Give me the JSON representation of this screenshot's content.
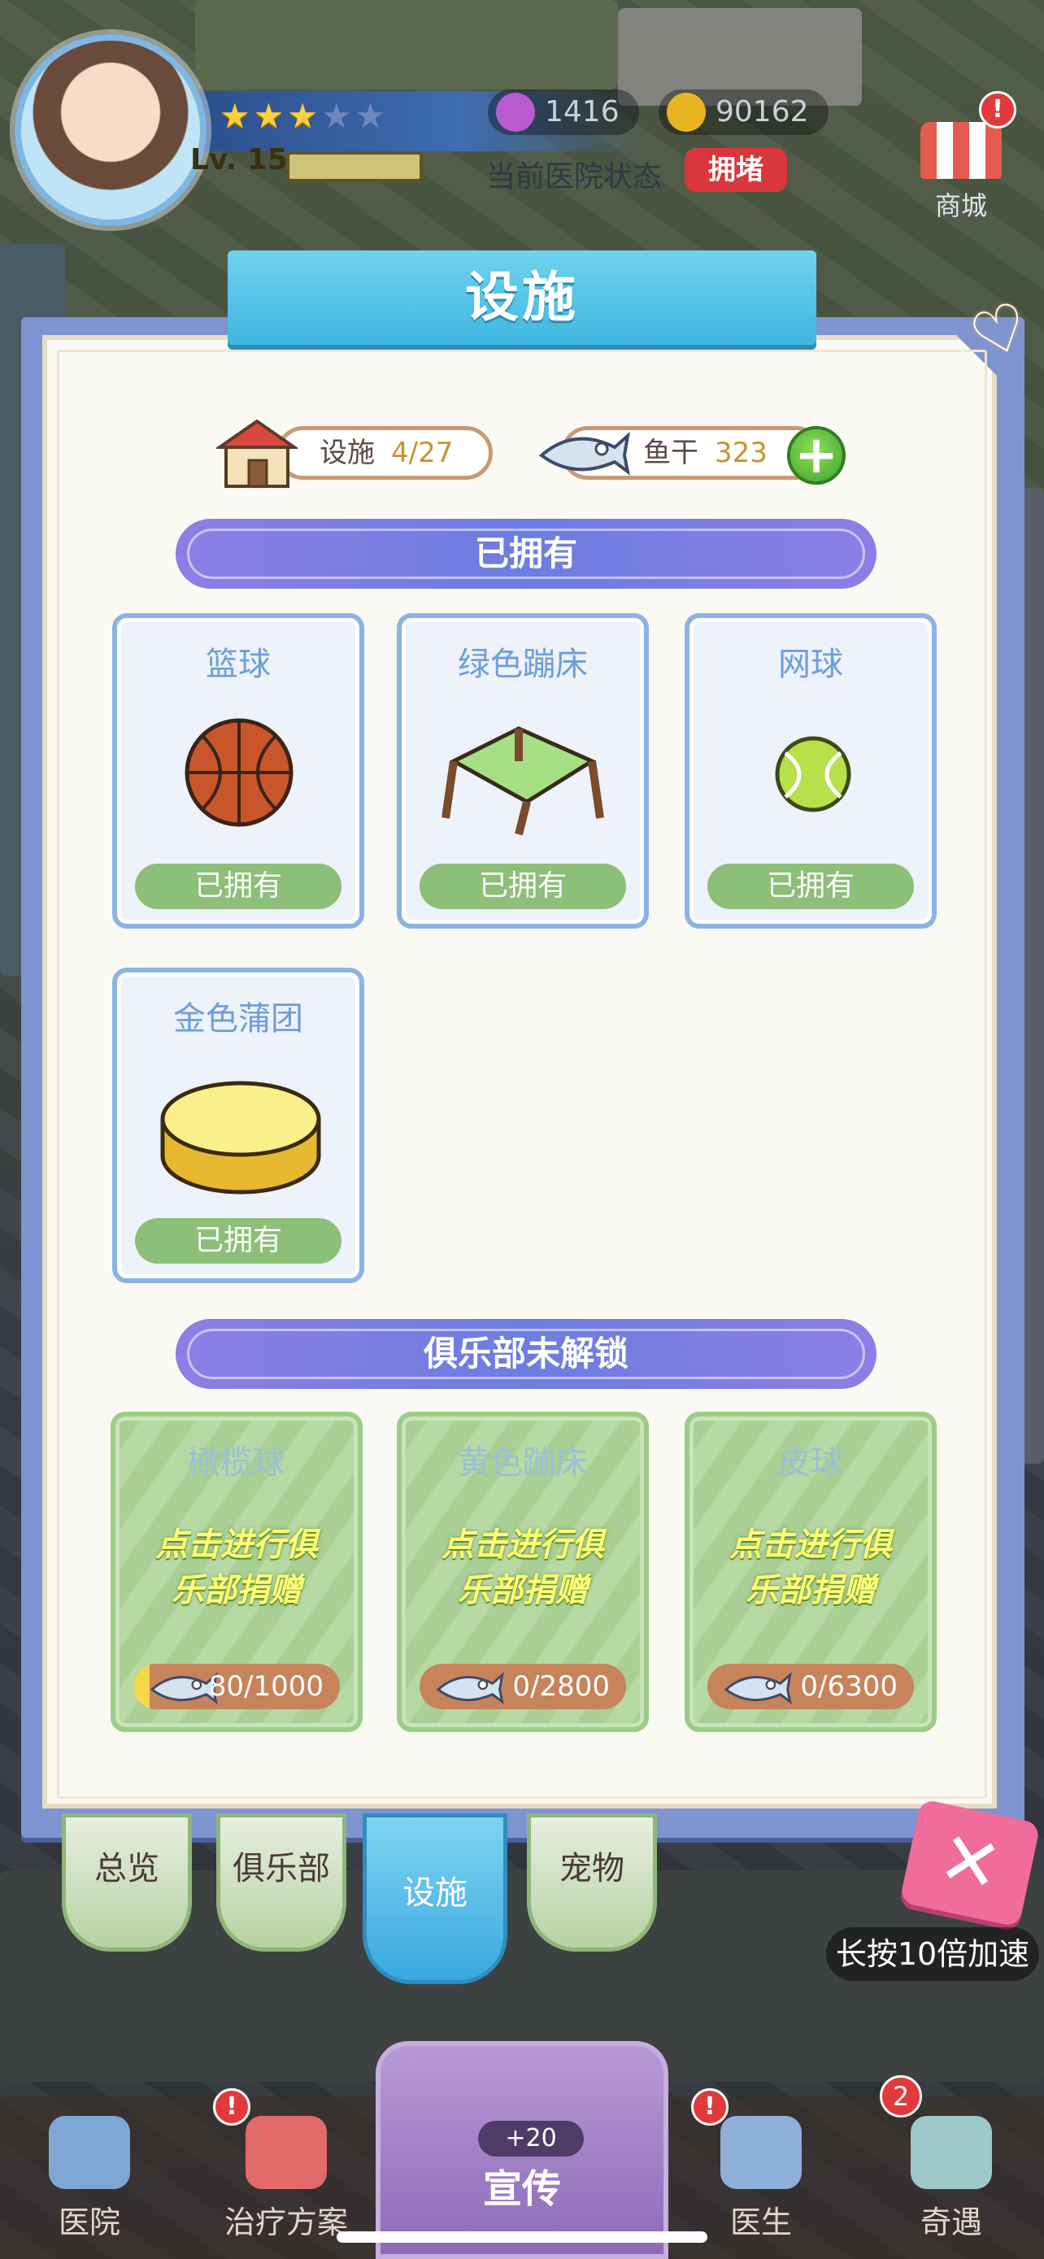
{
  "hud": {
    "level": "Lv. 15",
    "stars_filled": 3,
    "stars_total": 5,
    "gems": "1416",
    "coins": "90162",
    "hospital_status_label": "当前医院状态",
    "hospital_status": "拥堵",
    "shop_label": "商城",
    "alert": "!"
  },
  "modal": {
    "title": "设施",
    "facilities_label": "设施",
    "facilities_count": "4/27",
    "fish_label": "鱼干",
    "fish_count": "323",
    "owned_section": "已拥有",
    "locked_section": "俱乐部未解锁",
    "owned_items": [
      {
        "name": "篮球",
        "button": "已拥有",
        "icon": "basketball-icon"
      },
      {
        "name": "绿色蹦床",
        "button": "已拥有",
        "icon": "trampoline-icon"
      },
      {
        "name": "网球",
        "button": "已拥有",
        "icon": "tennis-ball-icon"
      },
      {
        "name": "金色蒲团",
        "button": "已拥有",
        "icon": "cushion-icon"
      }
    ],
    "locked_items": [
      {
        "name": "橄榄球",
        "hint_line1": "点击进行俱",
        "hint_line2": "乐部捐赠",
        "progress": "80/1000",
        "fraction": 0.08
      },
      {
        "name": "黄色蹦床",
        "hint_line1": "点击进行俱",
        "hint_line2": "乐部捐赠",
        "progress": "0/2800",
        "fraction": 0
      },
      {
        "name": "皮球",
        "hint_line1": "点击进行俱",
        "hint_line2": "乐部捐赠",
        "progress": "0/6300",
        "fraction": 0
      }
    ]
  },
  "tabs": [
    "总览",
    "俱乐部",
    "设施",
    "宠物"
  ],
  "active_tab": "设施",
  "speed_tip": "长按10倍加速",
  "nav": {
    "hospital": "医院",
    "treatment": "治疗方案",
    "promote": "宣传",
    "promote_bonus": "+20",
    "doctor": "医生",
    "adventure": "奇遇",
    "adventure_badge": "2",
    "alert": "!"
  },
  "colors": {
    "accent_blue": "#3fb6e0",
    "section_purple": "#6c7de0",
    "owned_green": "#8cbf78",
    "status_red": "#d9363e"
  }
}
